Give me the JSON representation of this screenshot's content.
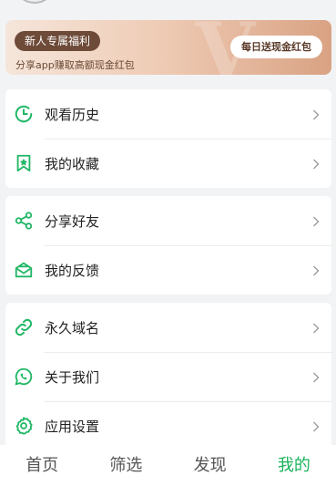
{
  "banner": {
    "tag": "新人专属福利",
    "subtitle": "分享app赚取高额现金红包",
    "button": "每日送现金红包"
  },
  "menu_groups": [
    {
      "items": [
        {
          "label": "观看历史",
          "icon": "clock-icon"
        },
        {
          "label": "我的收藏",
          "icon": "bookmark-star-icon"
        }
      ]
    },
    {
      "items": [
        {
          "label": "分享好友",
          "icon": "share-icon"
        },
        {
          "label": "我的反馈",
          "icon": "feedback-mail-icon"
        }
      ]
    },
    {
      "items": [
        {
          "label": "永久域名",
          "icon": "link-icon"
        },
        {
          "label": "关于我们",
          "icon": "chat-bubble-icon"
        },
        {
          "label": "应用设置",
          "icon": "gear-icon"
        }
      ]
    }
  ],
  "tabbar": {
    "tabs": [
      {
        "label": "首页"
      },
      {
        "label": "筛选"
      },
      {
        "label": "发现"
      },
      {
        "label": "我的",
        "active": true
      }
    ]
  },
  "colors": {
    "accent": "#19b35c",
    "icon": "#21b766",
    "banner_tag_bg": "#6e4a38",
    "background": "#f2f3f5"
  }
}
